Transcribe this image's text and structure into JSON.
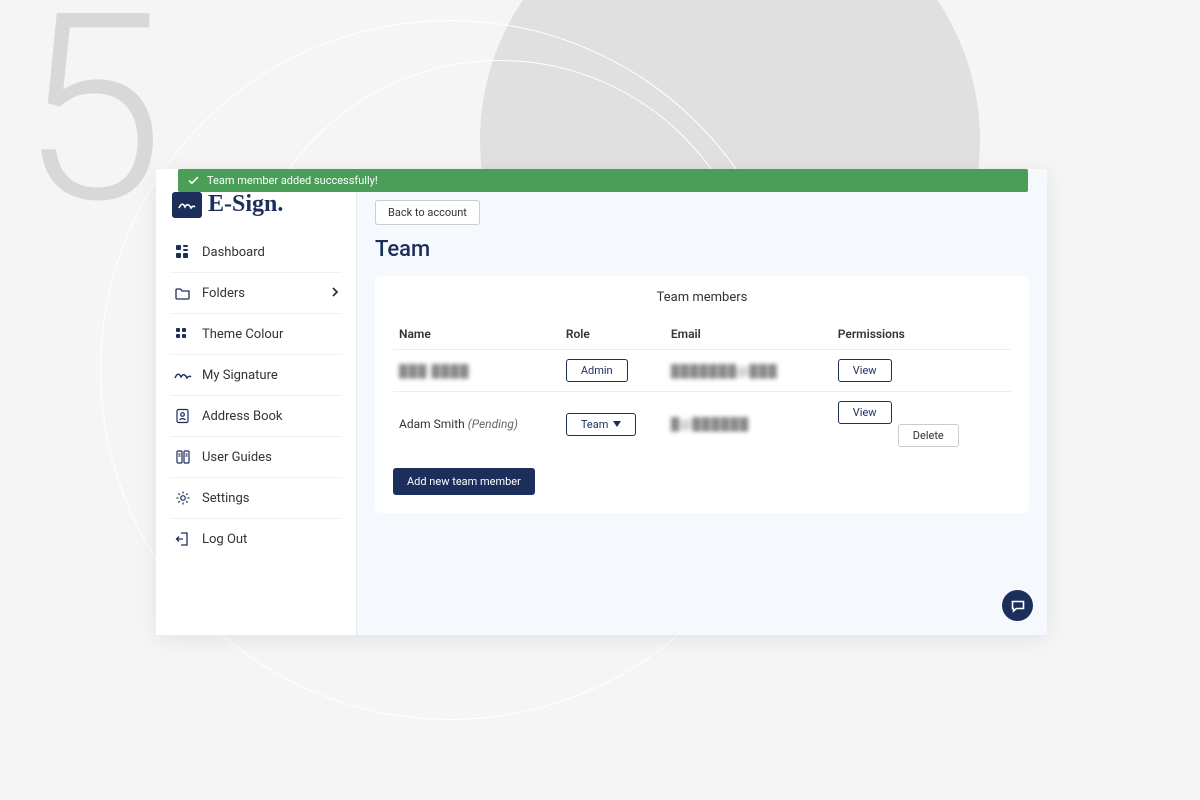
{
  "banner": {
    "message": "Team member added successfully!"
  },
  "brand": {
    "name": "E-Sign."
  },
  "sidebar": {
    "items": [
      {
        "label": "Dashboard",
        "icon": "dashboard"
      },
      {
        "label": "Folders",
        "icon": "folder",
        "hasChevron": true
      },
      {
        "label": "Theme Colour",
        "icon": "palette"
      },
      {
        "label": "My Signature",
        "icon": "signature"
      },
      {
        "label": "Address Book",
        "icon": "addressbook"
      },
      {
        "label": "User Guides",
        "icon": "guides"
      },
      {
        "label": "Settings",
        "icon": "gear"
      },
      {
        "label": "Log Out",
        "icon": "logout"
      }
    ]
  },
  "main": {
    "back_label": "Back to account",
    "page_title": "Team",
    "card_title": "Team members",
    "columns": {
      "name": "Name",
      "role": "Role",
      "email": "Email",
      "permissions": "Permissions"
    },
    "rows": [
      {
        "name": "███ ████",
        "role": "Admin",
        "email": "███████@███",
        "redacted": true,
        "pending": false,
        "view_label": "View",
        "delete_label": ""
      },
      {
        "name": "Adam Smith",
        "pending_label": "(Pending)",
        "role": "Team",
        "email": "█@██████",
        "redacted": true,
        "pending": true,
        "role_dropdown": true,
        "view_label": "View",
        "delete_label": "Delete"
      }
    ],
    "add_label": "Add new team member"
  },
  "bg": {
    "number": "5"
  }
}
